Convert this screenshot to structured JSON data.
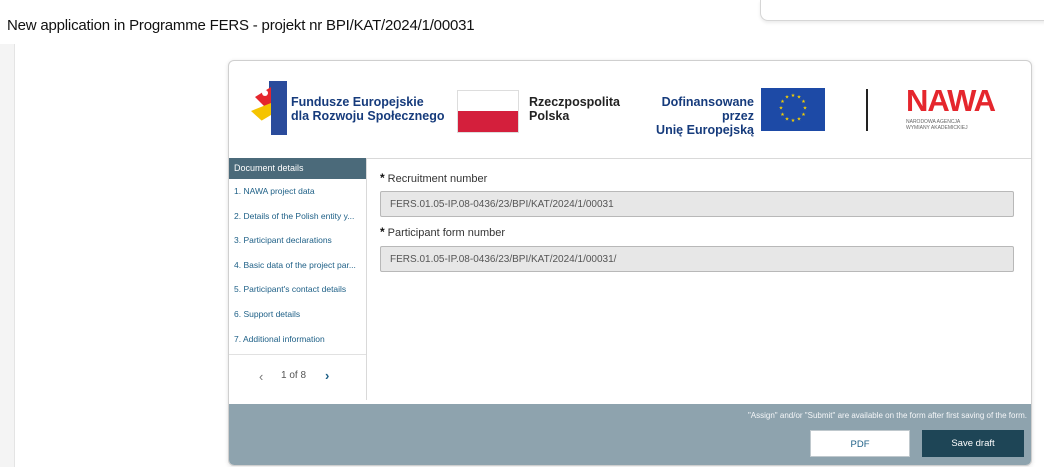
{
  "window": {
    "title": "New application in Programme FERS - projekt nr BPI/KAT/2024/1/00031"
  },
  "logos": {
    "fe_line1": "Fundusze Europejskie",
    "fe_line2": "dla Rozwoju Społecznego",
    "pl_line1": "Rzeczpospolita",
    "pl_line2": "Polska",
    "eu_line1": "Dofinansowane przez",
    "eu_line2": "Unię Europejską",
    "nawa_word": "NAWA",
    "nawa_sub1": "NARODOWA AGENCJA",
    "nawa_sub2": "WYMIANY AKADEMICKIEJ"
  },
  "sidebar": {
    "header": "Document details",
    "items": [
      {
        "label": "1. NAWA project data"
      },
      {
        "label": "2. Details of the Polish entity y..."
      },
      {
        "label": "3. Participant declarations"
      },
      {
        "label": "4. Basic data of the project par..."
      },
      {
        "label": "5. Participant's contact details"
      },
      {
        "label": "6. Support details"
      },
      {
        "label": "7. Additional information"
      }
    ],
    "pager": "1 of 8"
  },
  "form": {
    "required_mark": "*",
    "recruitment_label": "Recruitment number",
    "recruitment_value": "FERS.01.05-IP.08-0436/23/BPI/KAT/2024/1/00031",
    "participant_label": "Participant form number",
    "participant_value": "FERS.01.05-IP.08-0436/23/BPI/KAT/2024/1/00031/"
  },
  "footer": {
    "note": "\"Assign\" and/or \"Submit\" are available on the form after first saving of the form.",
    "pdf_label": "PDF",
    "save_label": "Save draft"
  },
  "colors": {
    "sidebar_header": "#4b6a7a",
    "footer_bar": "#8ea3ae",
    "save_button": "#1e4556",
    "link_blue": "#1d5f86",
    "nawa_red": "#e5262d"
  }
}
